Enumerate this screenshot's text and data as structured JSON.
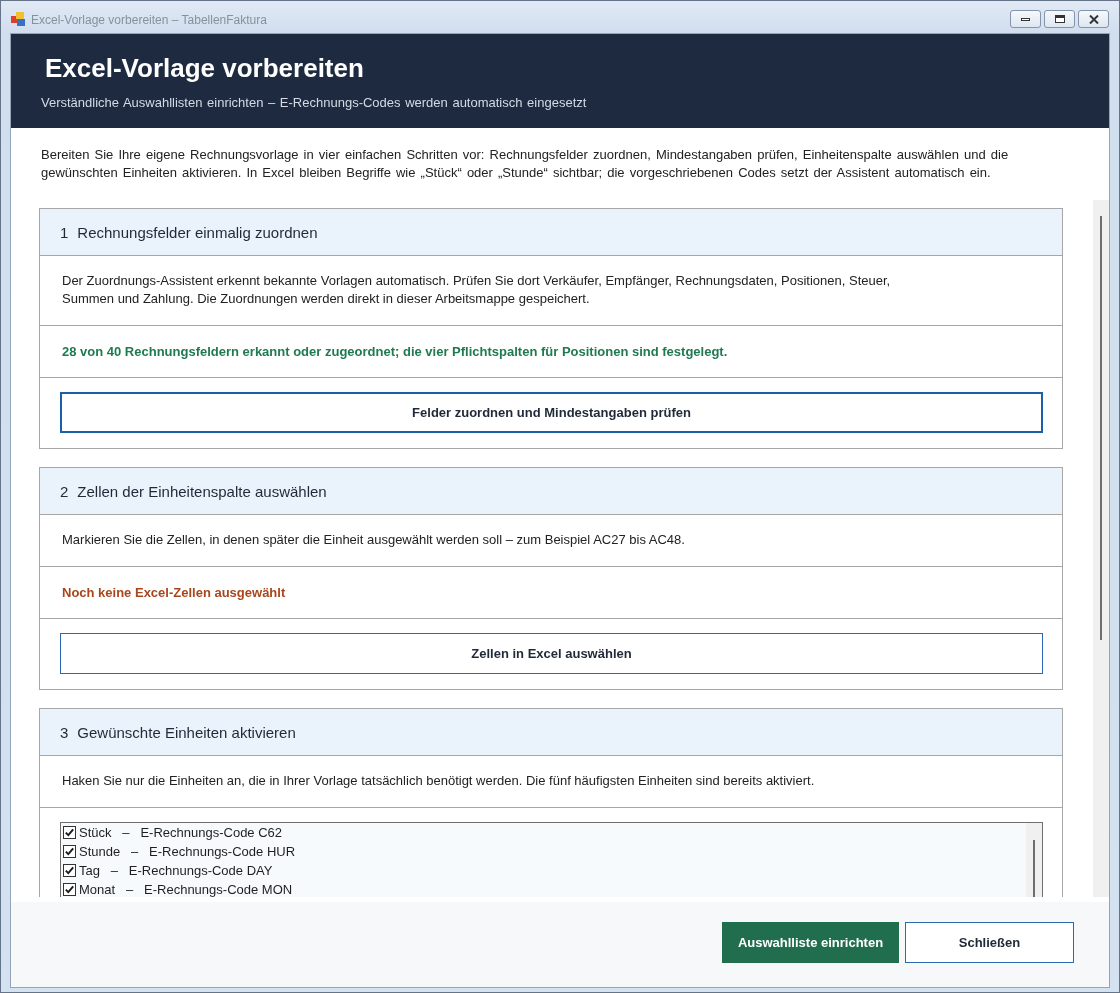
{
  "window": {
    "title": "Excel-Vorlage vorbereiten – TabellenFaktura"
  },
  "header": {
    "title": "Excel-Vorlage vorbereiten",
    "subtitle": "Verständliche Auswahllisten einrichten – E-Rechnungs-Codes werden automatisch eingesetzt"
  },
  "intro": "Bereiten Sie Ihre eigene Rechnungsvorlage in vier einfachen Schritten vor: Rechnungsfelder zuordnen, Mindestangaben prüfen, Einheitenspalte auswählen und die gewünschten Einheiten aktivieren. In Excel bleiben Begriffe wie „Stück“ oder „Stunde“ sichtbar; die vorgeschriebenen Codes setzt der Assistent automatisch ein.",
  "sections": [
    {
      "number": "1",
      "title": "Rechnungsfelder einmalig zuordnen",
      "description": "Der Zuordnungs-Assistent erkennt bekannte Vorlagen automatisch. Prüfen Sie dort Verkäufer, Empfänger, Rechnungsdaten, Positionen, Steuer, Summen und Zahlung. Die Zuordnungen werden direkt in dieser Arbeitsmappe gespeichert.",
      "status": {
        "kind": "success",
        "text": "28 von 40 Rechnungsfeldern erkannt oder zugeordnet; die vier Pflichtspalten für Positionen sind festgelegt."
      },
      "button": {
        "label": "Felder zuordnen und Mindestangaben prüfen",
        "focused": true
      }
    },
    {
      "number": "2",
      "title": "Zellen der Einheitenspalte auswählen",
      "description": "Markieren Sie die Zellen, in denen später die Einheit ausgewählt werden soll – zum Beispiel AC27 bis AC48.",
      "status": {
        "kind": "warning",
        "text": "Noch keine Excel-Zellen ausgewählt"
      },
      "button": {
        "label": "Zellen in Excel auswählen",
        "focused": false
      }
    },
    {
      "number": "3",
      "title": "Gewünschte Einheiten aktivieren",
      "description": "Haken Sie nur die Einheiten an, die in Ihrer Vorlage tatsächlich benötigt werden. Die fünf häufigsten Einheiten sind bereits aktiviert.",
      "units": [
        {
          "label": "Stück   –   E-Rechnungs-Code C62",
          "checked": true
        },
        {
          "label": "Stunde   –   E-Rechnungs-Code HUR",
          "checked": true
        },
        {
          "label": "Tag   –   E-Rechnungs-Code DAY",
          "checked": true
        },
        {
          "label": "Monat   –   E-Rechnungs-Code MON",
          "checked": true
        }
      ]
    }
  ],
  "footer": {
    "buttons": [
      {
        "label": "Auswahlliste einrichten",
        "kind": "primary"
      },
      {
        "label": "Schließen",
        "kind": "secondary"
      }
    ]
  }
}
